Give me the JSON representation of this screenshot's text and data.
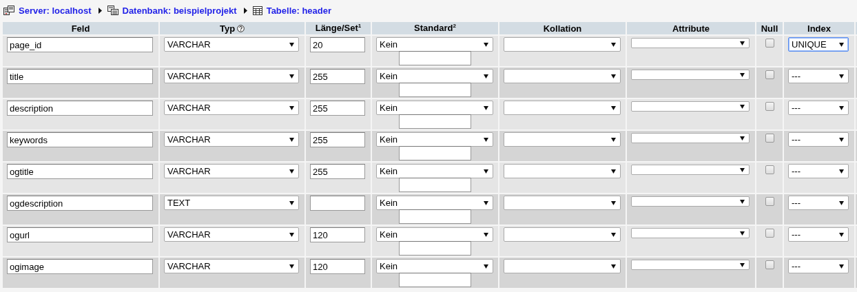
{
  "breadcrumb": [
    {
      "kind": "server",
      "label": "Server: localhost"
    },
    {
      "kind": "database",
      "label": "Datenbank: beispielprojekt"
    },
    {
      "kind": "table",
      "label": "Tabelle: header"
    }
  ],
  "table": {
    "columns": [
      {
        "label": "Feld",
        "help": false
      },
      {
        "label": "Typ",
        "help": true
      },
      {
        "label": "Länge/Set$^{1}$",
        "help": false
      },
      {
        "label": "Standard$^{2}$",
        "help": false
      },
      {
        "label": "Kollation",
        "help": false
      },
      {
        "label": "Attribute",
        "help": false
      },
      {
        "label": "Null",
        "help": false
      },
      {
        "label": "Index",
        "help": false
      }
    ],
    "rows": [
      {
        "name": "page_id",
        "type": "VARCHAR",
        "length": "20",
        "default": "Kein",
        "null": false,
        "index": "UNIQUE",
        "index_focused": true
      },
      {
        "name": "title",
        "type": "VARCHAR",
        "length": "255",
        "default": "Kein",
        "null": false,
        "index": "---",
        "index_focused": false
      },
      {
        "name": "description",
        "type": "VARCHAR",
        "length": "255",
        "default": "Kein",
        "null": false,
        "index": "---",
        "index_focused": false
      },
      {
        "name": "keywords",
        "type": "VARCHAR",
        "length": "255",
        "default": "Kein",
        "null": false,
        "index": "---",
        "index_focused": false
      },
      {
        "name": "ogtitle",
        "type": "VARCHAR",
        "length": "255",
        "default": "Kein",
        "null": false,
        "index": "---",
        "index_focused": false
      },
      {
        "name": "ogdescription",
        "type": "TEXT",
        "length": "",
        "default": "Kein",
        "null": false,
        "index": "---",
        "index_focused": false
      },
      {
        "name": "ogurl",
        "type": "VARCHAR",
        "length": "120",
        "default": "Kein",
        "null": false,
        "index": "---",
        "index_focused": false
      },
      {
        "name": "ogimage",
        "type": "VARCHAR",
        "length": "120",
        "default": "Kein",
        "null": false,
        "index": "---",
        "index_focused": false
      }
    ]
  }
}
